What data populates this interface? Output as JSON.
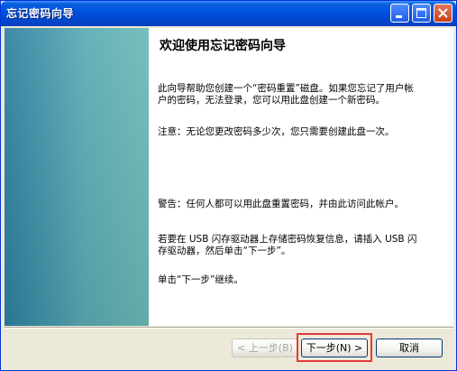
{
  "window": {
    "title": "忘记密码向导"
  },
  "titlebar": {
    "min_icon": "minimize-icon",
    "max_icon": "maximize-icon",
    "close_icon": "close-icon"
  },
  "content": {
    "heading": "欢迎使用忘记密码向导",
    "p1": "此向导帮助您创建一个“密码重置”磁盘。如果您忘记了用户帐户的密码，无法登录，您可以用此盘创建一个新密码。",
    "p2": "注意：无论您更改密码多少次，您只需要创建此盘一次。",
    "p3": "警告：任何人都可以用此盘重置密码，并由此访问此帐户。",
    "p4": "若要在 USB 闪存驱动器上存储密码恢复信息，请插入 USB 闪存驱动器，然后单击“下一步”。",
    "p5": "单击“下一步”继续。"
  },
  "buttons": {
    "back": "< 上一步(B)",
    "next": "下一步(N) >",
    "cancel": "取消"
  },
  "colors": {
    "titlebar": "#0053e2",
    "highlight": "#e53b3b",
    "side_panel": "#5aaab3"
  }
}
